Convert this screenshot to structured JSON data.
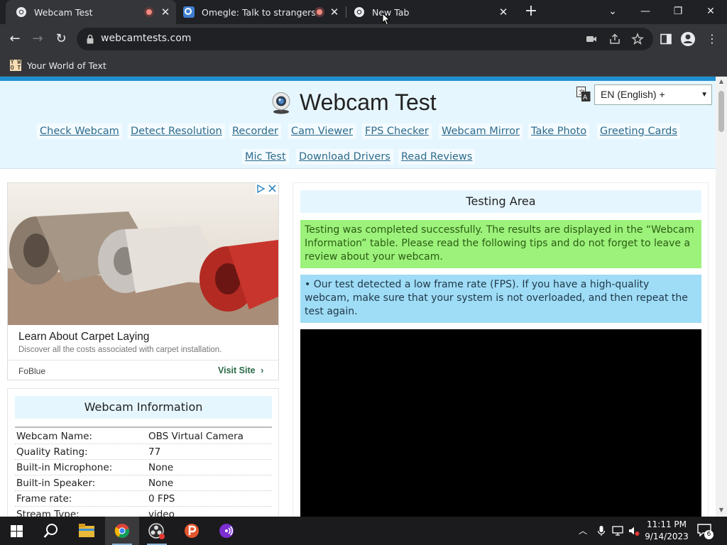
{
  "browser": {
    "tabs": [
      {
        "title": "Webcam Test",
        "active": true,
        "recording": true
      },
      {
        "title": "Omegle: Talk to strangers!",
        "active": false,
        "recording": true
      },
      {
        "title": "New Tab",
        "active": false,
        "recording": false
      }
    ],
    "url": "webcamtests.com",
    "bookmarks": [
      {
        "label": "Your World of Text",
        "icon_text": "Y W\nO T"
      }
    ],
    "colors": {
      "tabstrip": "#202124",
      "toolbar": "#35363a",
      "omnibox": "#202124"
    }
  },
  "site": {
    "title": "Webcam Test",
    "language": "EN (English) +",
    "nav_links": [
      "Check Webcam",
      "Detect Resolution",
      "Recorder",
      "Cam Viewer",
      "FPS Checker",
      "Webcam Mirror",
      "Take Photo",
      "Greeting Cards",
      "Mic Test",
      "Download Drivers",
      "Read Reviews"
    ],
    "colors": {
      "accent_bar": "#1f8fd0",
      "header_bg": "#e6f6ff",
      "link": "#2e6b8c"
    }
  },
  "ad": {
    "title": "Learn About Carpet Laying",
    "description": "Discover all the costs associated with carpet installation.",
    "brand": "FoBlue",
    "cta": "Visit Site"
  },
  "webcam_info": {
    "heading": "Webcam Information",
    "rows": [
      {
        "key": "Webcam Name:",
        "value": "OBS Virtual Camera"
      },
      {
        "key": "Quality Rating:",
        "value": "77"
      },
      {
        "key": "Built-in Microphone:",
        "value": "None"
      },
      {
        "key": "Built-in Speaker:",
        "value": "None"
      },
      {
        "key": "Frame rate:",
        "value": "0 FPS"
      },
      {
        "key": "Stream Type:",
        "value": "video"
      }
    ]
  },
  "testing_area": {
    "heading": "Testing Area",
    "success_message": "Testing was completed successfully. The results are displayed in the “Webcam Information” table. Please read the following tips and do not forget to leave a review about your webcam.",
    "tip": "• Our test detected a low frame rate (FPS). If you have a high-quality webcam, make sure that your system is not overloaded, and then repeat the test again.",
    "colors": {
      "success_bg": "#9cf27a",
      "tip_bg": "#9fdcf6",
      "video_bg": "#000000"
    }
  },
  "taskbar": {
    "apps": [
      "start-icon",
      "search-icon",
      "file-explorer-icon",
      "chrome-icon",
      "obs-icon",
      "pdf-app-icon",
      "podcast-app-icon"
    ],
    "time": "11:11 PM",
    "date": "9/14/2023",
    "notification_count": "6"
  }
}
